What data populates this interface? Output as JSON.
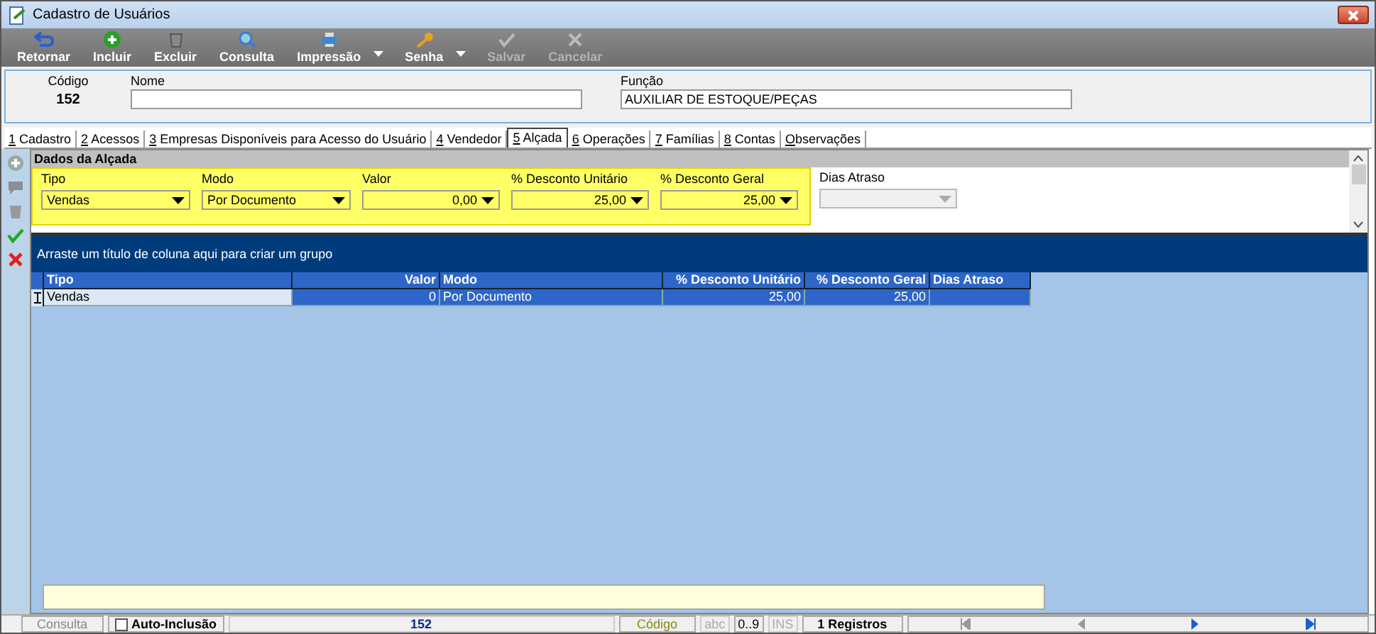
{
  "window": {
    "title": "Cadastro de Usuários"
  },
  "toolbar": [
    {
      "label": "Retornar",
      "kind": "back",
      "disabled": false,
      "dropdown": false
    },
    {
      "label": "Incluir",
      "kind": "plus",
      "disabled": false,
      "dropdown": false
    },
    {
      "label": "Excluir",
      "kind": "trash",
      "disabled": false,
      "dropdown": false
    },
    {
      "label": "Consulta",
      "kind": "search",
      "disabled": false,
      "dropdown": false
    },
    {
      "label": "Impressão",
      "kind": "printer",
      "disabled": false,
      "dropdown": true
    },
    {
      "label": "Senha",
      "kind": "key",
      "disabled": false,
      "dropdown": true
    },
    {
      "label": "Salvar",
      "kind": "check",
      "disabled": true,
      "dropdown": false
    },
    {
      "label": "Cancelar",
      "kind": "cross",
      "disabled": true,
      "dropdown": false
    }
  ],
  "header": {
    "codigo_label": "Código",
    "codigo": "152",
    "nome_label": "Nome",
    "funcao_label": "Função",
    "funcao": "AUXILIAR DE ESTOQUE/PEÇAS"
  },
  "tabs": [
    {
      "label": "1 Cadastro",
      "selected": false
    },
    {
      "label": "2 Acessos",
      "selected": false
    },
    {
      "label": "3 Empresas Disponíveis para Acesso do Usuário",
      "selected": false
    },
    {
      "label": "4 Vendedor",
      "selected": false
    },
    {
      "label": "5 Alçada",
      "selected": true
    },
    {
      "label": "6 Operações",
      "selected": false
    },
    {
      "label": "7 Famílias",
      "selected": false
    },
    {
      "label": "8 Contas",
      "selected": false
    },
    {
      "label": "Observações",
      "selected": false
    }
  ],
  "side_tools": [
    {
      "kind": "plus",
      "disabled": true
    },
    {
      "kind": "comment",
      "disabled": true
    },
    {
      "kind": "trash",
      "disabled": true
    },
    {
      "kind": "check",
      "disabled": false
    },
    {
      "kind": "cross",
      "disabled": false
    }
  ],
  "section": {
    "title": "Dados da Alçada",
    "fields": [
      {
        "label": "Tipo",
        "value": "Vendas",
        "highlighted": true,
        "disabled": false
      },
      {
        "label": "Modo",
        "value": "Por Documento",
        "highlighted": true,
        "disabled": false
      },
      {
        "label": "Valor",
        "value": "0,00",
        "highlighted": true,
        "disabled": false
      },
      {
        "label": "% Desconto Unitário",
        "value": "25,00",
        "highlighted": true,
        "disabled": false
      },
      {
        "label": "% Desconto Geral",
        "value": "25,00",
        "highlighted": true,
        "disabled": false
      },
      {
        "label": "Dias Atraso",
        "highlighted": false,
        "disabled": true
      }
    ]
  },
  "grid": {
    "group_hint": "Arraste um título de coluna aqui para criar um grupo",
    "columns": [
      "Tipo",
      "Valor",
      "Modo",
      "% Desconto Unitário",
      "% Desconto Geral",
      "Dias Atraso"
    ],
    "rows": [
      {
        "cells": [
          "Vendas",
          "0",
          "Por Documento",
          "25,00",
          "25,00",
          ""
        ]
      }
    ]
  },
  "status_bar": {
    "consulta": "Consulta",
    "auto_inclusao": {
      "label": "Auto-Inclusão",
      "checked": false
    },
    "record": "152",
    "codigo": "Código",
    "abc": "abc",
    "digits": "0..9",
    "ins": "INS",
    "count": "1 Registros"
  }
}
